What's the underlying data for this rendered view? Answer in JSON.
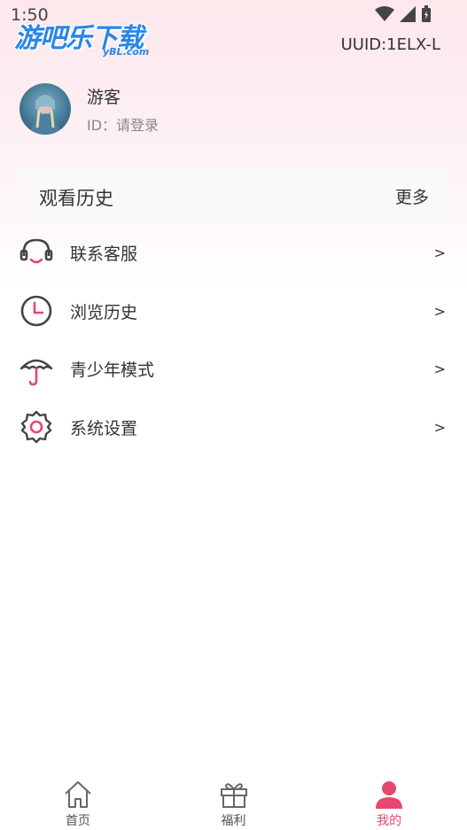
{
  "status_bar": {
    "time": "1:50"
  },
  "logo": {
    "text": "游吧乐下载",
    "sub": "yBL.com"
  },
  "header": {
    "uuid": "UUID:1ELX-L"
  },
  "profile": {
    "name": "游客",
    "id_line": "ID：请登录"
  },
  "history": {
    "title": "观看历史",
    "more": "更多"
  },
  "menu": {
    "items": [
      {
        "label": "联系客服",
        "arrow": ">",
        "icon": "headset-icon"
      },
      {
        "label": "浏览历史",
        "arrow": ">",
        "icon": "clock-icon"
      },
      {
        "label": "青少年模式",
        "arrow": ">",
        "icon": "umbrella-icon"
      },
      {
        "label": "系统设置",
        "arrow": ">",
        "icon": "gear-icon"
      }
    ]
  },
  "tabbar": {
    "tabs": [
      {
        "label": "首页",
        "icon": "home-icon"
      },
      {
        "label": "福利",
        "icon": "gift-icon"
      },
      {
        "label": "我的",
        "icon": "user-icon",
        "active": true
      }
    ]
  },
  "colors": {
    "accent": "#e8476f",
    "logo": "#2a86e8"
  }
}
